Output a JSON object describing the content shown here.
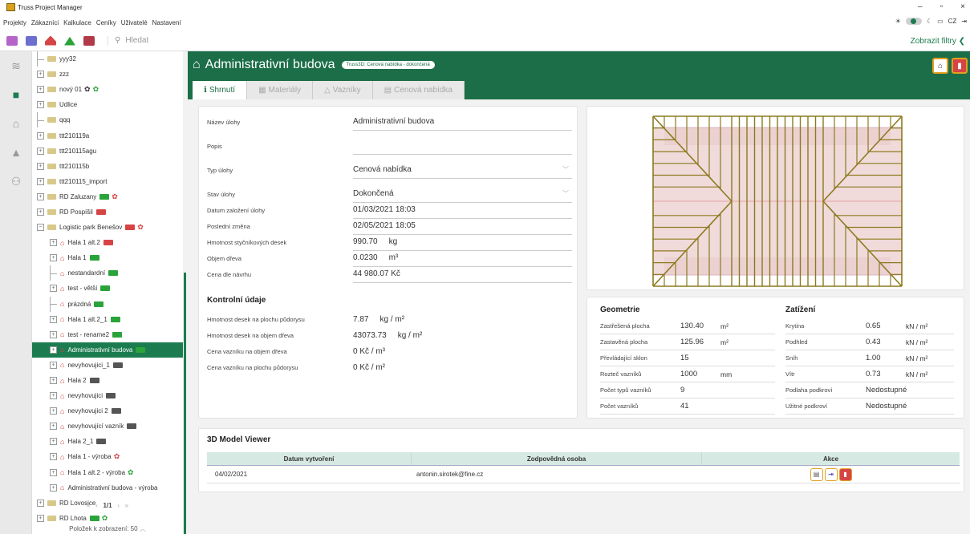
{
  "app": {
    "title": "Truss Project Manager",
    "lang": "CZ"
  },
  "menu": [
    "Projekty",
    "Zákazníci",
    "Kalkulace",
    "Ceníky",
    "Uživatelé",
    "Nastavení"
  ],
  "search": {
    "placeholder": "Hledat"
  },
  "filters_label": "Zobrazit filtry",
  "tree": [
    {
      "label": "yyy32",
      "type": "folder",
      "level": 0,
      "exp": false
    },
    {
      "label": "zzz",
      "type": "folder",
      "level": 0,
      "exp": true
    },
    {
      "label": "nový 01",
      "type": "folder",
      "level": 0,
      "exp": true,
      "badges": [
        "gear-gray",
        "gear-green"
      ]
    },
    {
      "label": "Udlice",
      "type": "folder",
      "level": 0,
      "exp": true
    },
    {
      "label": "qqq",
      "type": "folder",
      "level": 0,
      "exp": false
    },
    {
      "label": "ttt210119a",
      "type": "folder",
      "level": 0,
      "exp": true
    },
    {
      "label": "ttt210115agu",
      "type": "folder",
      "level": 0,
      "exp": true
    },
    {
      "label": "ttt210115b",
      "type": "folder",
      "level": 0,
      "exp": true
    },
    {
      "label": "ttt210115_import",
      "type": "folder",
      "level": 0,
      "exp": true
    },
    {
      "label": "RD Zaluzany",
      "type": "folder",
      "level": 0,
      "exp": true,
      "badges": [
        "cam-green",
        "gear-red"
      ]
    },
    {
      "label": "RD Pospíšil",
      "type": "folder",
      "level": 0,
      "exp": true,
      "badges": [
        "cam-red"
      ]
    },
    {
      "label": "Logistic park Benešov",
      "type": "folder",
      "level": 0,
      "exp": true,
      "open": true,
      "badges": [
        "cam-red",
        "gear-red"
      ]
    },
    {
      "label": "Hala 1 alt.2",
      "type": "house",
      "level": 1,
      "exp": true,
      "badges": [
        "cam-red"
      ]
    },
    {
      "label": "Hala 1",
      "type": "house",
      "level": 1,
      "exp": true,
      "badges": [
        "cam-green"
      ]
    },
    {
      "label": "nestandardní",
      "type": "house",
      "level": 1,
      "exp": false,
      "badges": [
        "cam-green"
      ]
    },
    {
      "label": "test - větší",
      "type": "house",
      "level": 1,
      "exp": true,
      "badges": [
        "cam-green"
      ]
    },
    {
      "label": "prázdná",
      "type": "house",
      "level": 1,
      "exp": false,
      "badges": [
        "cam-green"
      ]
    },
    {
      "label": "Hala 1 alt.2_1",
      "type": "house",
      "level": 1,
      "exp": true,
      "badges": [
        "cam-green"
      ]
    },
    {
      "label": "test - rename2",
      "type": "house",
      "level": 1,
      "exp": true,
      "badges": [
        "cam-green"
      ]
    },
    {
      "label": "Administrativní budova",
      "type": "house",
      "level": 1,
      "exp": true,
      "selected": true,
      "badges": [
        "cam-green"
      ]
    },
    {
      "label": "nevyhovujici_1",
      "type": "house",
      "level": 1,
      "exp": true,
      "badges": [
        "cam-gray"
      ]
    },
    {
      "label": "Hala 2",
      "type": "house",
      "level": 1,
      "exp": true,
      "badges": [
        "cam-gray"
      ]
    },
    {
      "label": "nevyhovujici",
      "type": "house",
      "level": 1,
      "exp": true,
      "badges": [
        "cam-gray"
      ]
    },
    {
      "label": "nevyhovujici 2",
      "type": "house",
      "level": 1,
      "exp": true,
      "badges": [
        "cam-gray"
      ]
    },
    {
      "label": "nevyhovující vazník",
      "type": "house",
      "level": 1,
      "exp": true,
      "badges": [
        "cam-gray"
      ]
    },
    {
      "label": "Hala 2_1",
      "type": "house",
      "level": 1,
      "exp": true,
      "badges": [
        "cam-gray"
      ]
    },
    {
      "label": "Hala 1 - výroba",
      "type": "house",
      "level": 1,
      "exp": true,
      "badges": [
        "gear-red"
      ]
    },
    {
      "label": "Hala 1 alt.2 - výroba",
      "type": "house",
      "level": 1,
      "exp": true,
      "badges": [
        "gear-green"
      ]
    },
    {
      "label": "Administrativní budova - výroba",
      "type": "house",
      "level": 1,
      "exp": true
    },
    {
      "label": "RD Lovosice",
      "type": "folder",
      "level": 0,
      "exp": true
    },
    {
      "label": "RD Lhota",
      "type": "folder",
      "level": 0,
      "exp": true,
      "badges": [
        "cam-green",
        "gear-green"
      ]
    }
  ],
  "pager": {
    "text": "1/1",
    "per_page_label": "Položek k zobrazení:",
    "per_page": "50"
  },
  "header": {
    "title": "Administrativní budova",
    "pill": "Truss3D: Cenová nabídka - dokončená"
  },
  "tabs": [
    "Shrnutí",
    "Materiály",
    "Vazníky",
    "Cenová nabídka"
  ],
  "form": [
    {
      "label": "Název úlohy",
      "value": "Administrativní budova"
    },
    {
      "label": "Popis",
      "value": ""
    },
    {
      "label": "Typ úlohy",
      "value": "Cenová nabídka",
      "select": true
    },
    {
      "label": "Stav úlohy",
      "value": "Dokončená",
      "select": true
    },
    {
      "label": "Datum založení úlohy",
      "value": "01/03/2021 18:03"
    },
    {
      "label": "Poslední změna",
      "value": "02/05/2021 18:05"
    },
    {
      "label": "Hmotnost styčníkových desek",
      "value": "990.70",
      "unit": "kg"
    },
    {
      "label": "Objem dřeva",
      "value": "0.0230",
      "unit": "m³"
    },
    {
      "label": "Cena dle návrhu",
      "value": "44 980.07 Kč"
    }
  ],
  "control": {
    "title": "Kontrolní údaje",
    "rows": [
      {
        "label": "Hmotnost desek na plochu půdorysu",
        "value": "7.87",
        "unit": "kg / m²"
      },
      {
        "label": "Hmotnost desek na objem dřeva",
        "value": "43073.73",
        "unit": "kg / m²"
      },
      {
        "label": "Cena vazníku na objem dřeva",
        "value": "0 Kč / m³"
      },
      {
        "label": "Cena vazníku na plochu půdorysu",
        "value": "0 Kč / m²"
      }
    ]
  },
  "geometry": {
    "title": "Geometrie",
    "rows": [
      {
        "label": "Zastřešená plocha",
        "value": "130.40",
        "unit": "m²"
      },
      {
        "label": "Zastavěná plocha",
        "value": "125.96",
        "unit": "m²"
      },
      {
        "label": "Převládající sklon",
        "value": "15",
        "unit": ""
      },
      {
        "label": "Rozteč vazníků",
        "value": "1000",
        "unit": "mm"
      },
      {
        "label": "Počet typů vazníků",
        "value": "9",
        "unit": ""
      },
      {
        "label": "Počet vazníků",
        "value": "41",
        "unit": ""
      }
    ]
  },
  "loads": {
    "title": "Zatížení",
    "rows": [
      {
        "label": "Krytina",
        "value": "0.65",
        "unit": "kN / m²"
      },
      {
        "label": "Podhled",
        "value": "0.43",
        "unit": "kN / m²"
      },
      {
        "label": "Sníh",
        "value": "1.00",
        "unit": "kN / m²"
      },
      {
        "label": "Vítr",
        "value": "0.73",
        "unit": "kN / m²"
      },
      {
        "label": "Podlaha podkroví",
        "value": "Nedostupné",
        "unit": ""
      },
      {
        "label": "Užitné podkroví",
        "value": "Nedostupné",
        "unit": ""
      }
    ]
  },
  "viewer": {
    "title": "3D Model Viewer",
    "columns": [
      "Datum vytvoření",
      "Zodpovědná osoba",
      "Akce"
    ],
    "rows": [
      {
        "date": "04/02/2021",
        "person": "antonin.sirotek@fine.cz"
      }
    ]
  },
  "colors": {
    "accent": "#1c6e48",
    "selected": "#1c7c50",
    "button_border": "#e2a020"
  }
}
